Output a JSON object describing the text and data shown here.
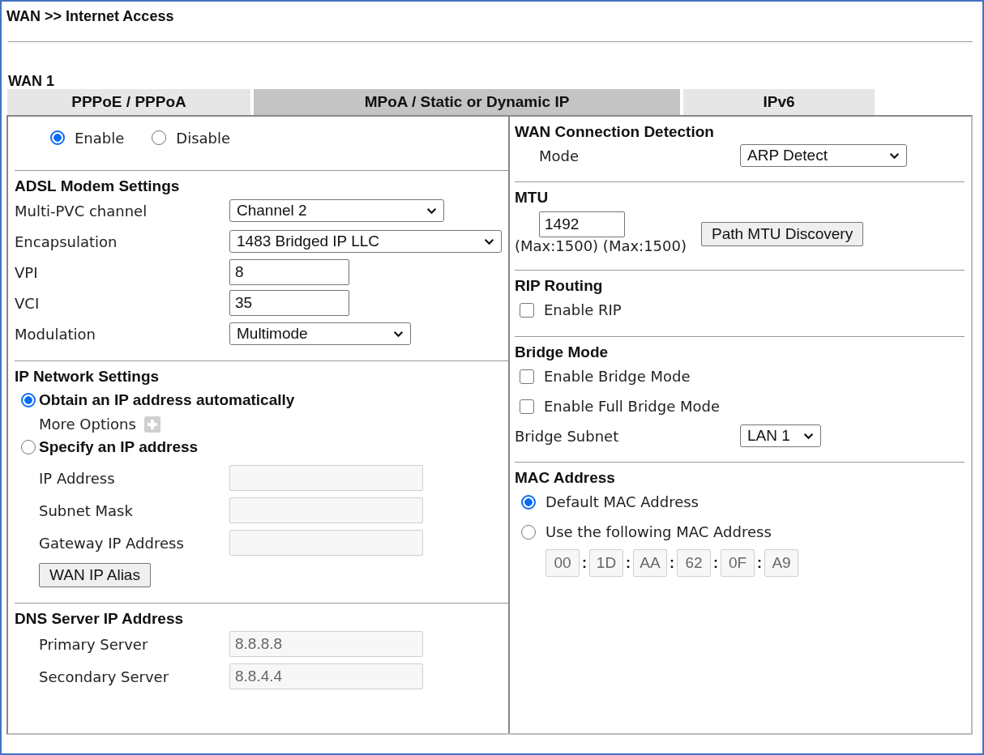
{
  "title": "WAN >> Internet Access",
  "group": "WAN 1",
  "tabs": [
    {
      "label": "PPPoE / PPPoA",
      "selected": false
    },
    {
      "label": "MPoA / Static or Dynamic IP",
      "selected": true
    },
    {
      "label": "IPv6",
      "selected": false
    }
  ],
  "status_options": [
    {
      "label": "Enable",
      "selected": true
    },
    {
      "label": "Disable",
      "selected": false
    }
  ],
  "adsl": {
    "heading": "ADSL Modem Settings",
    "fields": [
      {
        "label": "Multi-PVC channel",
        "kind": "select",
        "value": "Channel 2"
      },
      {
        "label": "Encapsulation",
        "kind": "select",
        "value": "1483 Bridged IP LLC"
      },
      {
        "label": "VPI",
        "kind": "text",
        "value": "8"
      },
      {
        "label": "VCI",
        "kind": "text",
        "value": "35"
      },
      {
        "label": "Modulation",
        "kind": "select",
        "value": "Multimode"
      }
    ]
  },
  "ip_network": {
    "heading": "IP Network Settings",
    "obtain": {
      "label": "Obtain an IP address automatically",
      "selected": true
    },
    "more_options": "More Options",
    "specify": {
      "label": "Specify an IP address",
      "selected": false
    },
    "fields": [
      {
        "label": "IP Address",
        "disabled": true
      },
      {
        "label": "Subnet Mask",
        "disabled": true
      },
      {
        "label": "Gateway IP Address",
        "disabled": true
      }
    ],
    "button": "WAN IP Alias"
  },
  "dns": {
    "heading": "DNS Server IP Address",
    "fields": [
      {
        "label": "Primary Server",
        "value": "8.8.8.8",
        "disabled": true
      },
      {
        "label": "Secondary Server",
        "value": "8.8.4.4",
        "disabled": true
      }
    ]
  },
  "detection": {
    "heading": "WAN Connection Detection",
    "mode_label": "Mode",
    "mode_value": "ARP Detect"
  },
  "mtu": {
    "heading": "MTU",
    "value": "1492",
    "note": "(Max:1500) (Max:1500)",
    "button": "Path MTU Discovery"
  },
  "rip": {
    "heading": "RIP Routing",
    "options": [
      {
        "label": "Enable RIP",
        "checked": false
      }
    ]
  },
  "bridge": {
    "heading": "Bridge Mode",
    "options": [
      {
        "label": "Enable Bridge Mode",
        "checked": false
      },
      {
        "label": "Enable Full Bridge Mode",
        "checked": false
      }
    ],
    "subnet_label": "Bridge Subnet",
    "subnet_value": "LAN 1"
  },
  "mac": {
    "heading": "MAC Address",
    "options": [
      {
        "label": "Default MAC Address",
        "selected": true
      },
      {
        "label": "Use the following MAC Address",
        "selected": false
      }
    ],
    "separator": ":",
    "octets_disabled": true,
    "octets": [
      "00",
      "1D",
      "AA",
      "62",
      "0F",
      "A9"
    ]
  }
}
